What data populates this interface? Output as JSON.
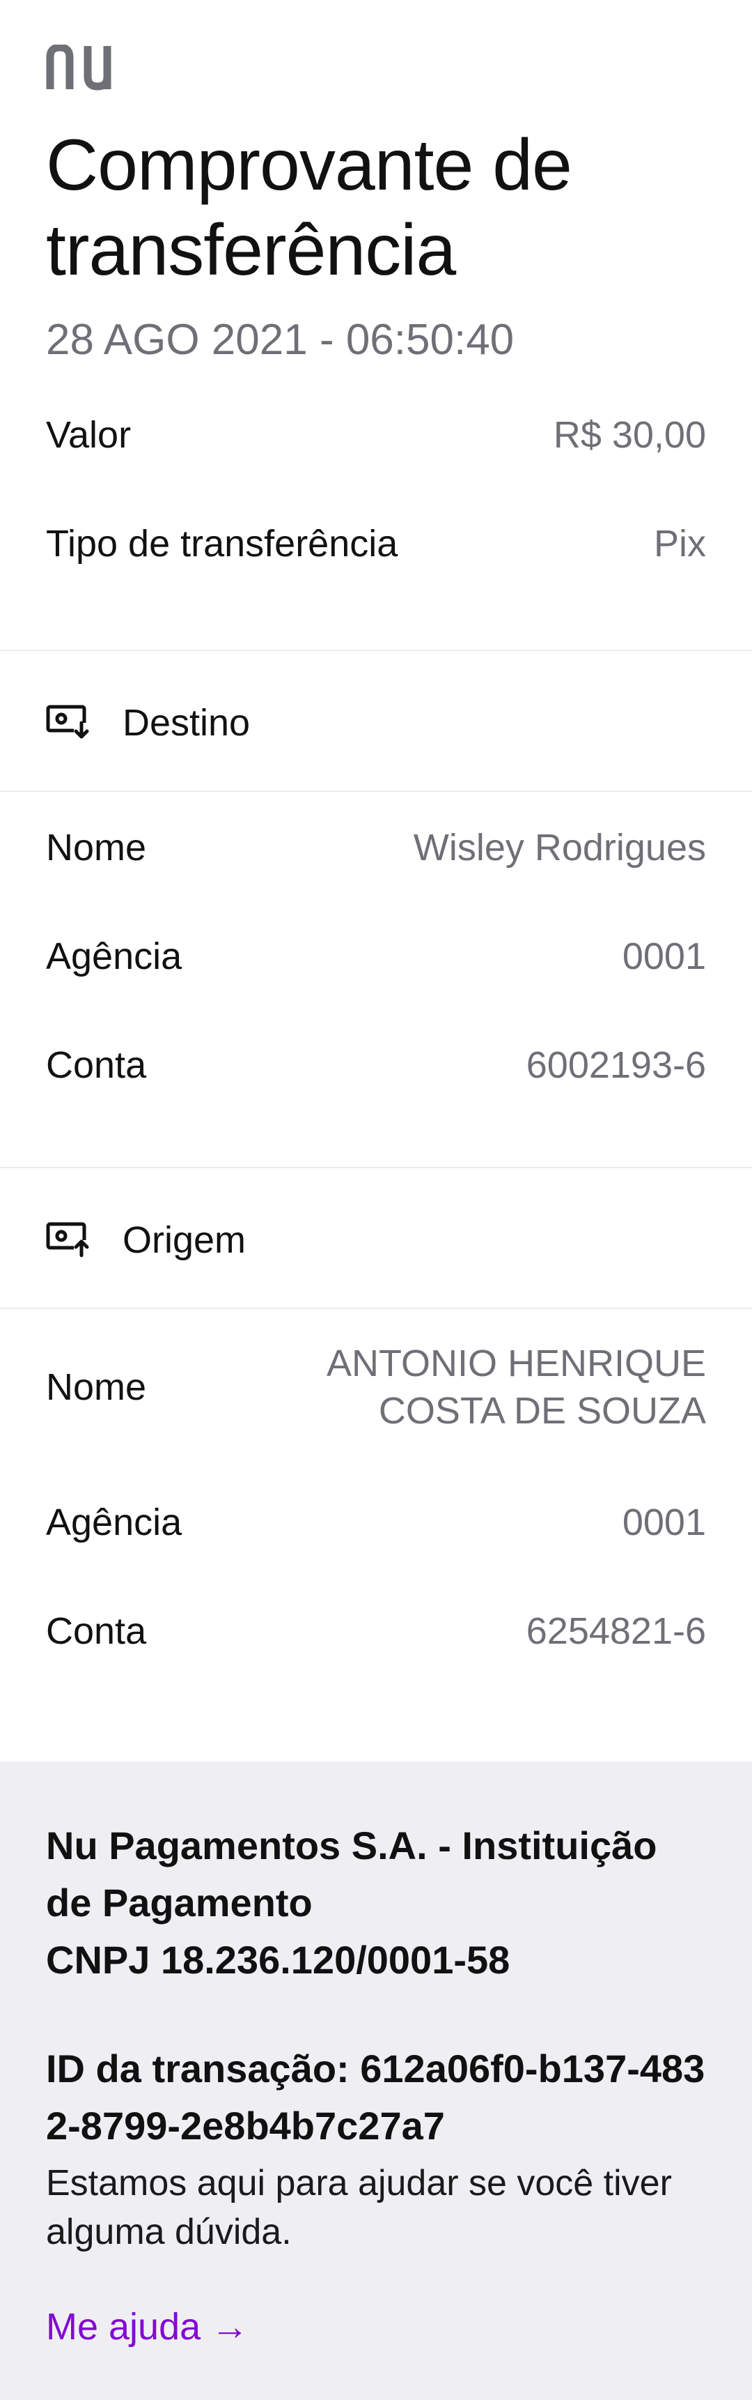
{
  "header": {
    "logo_text": "nu",
    "title": "Comprovante de transferência",
    "datetime": "28 AGO 2021 - 06:50:40"
  },
  "summary": {
    "value_label": "Valor",
    "value": "R$ 30,00",
    "type_label": "Tipo de transferência",
    "type": "Pix"
  },
  "destino": {
    "title": "Destino",
    "name_label": "Nome",
    "name": "Wisley Rodrigues",
    "agency_label": "Agência",
    "agency": "0001",
    "account_label": "Conta",
    "account": "6002193-6"
  },
  "origem": {
    "title": "Origem",
    "name_label": "Nome",
    "name_line1": "ANTONIO HENRIQUE",
    "name_line2": "COSTA DE SOUZA",
    "agency_label": "Agência",
    "agency": "0001",
    "account_label": "Conta",
    "account": "6254821-6"
  },
  "footer": {
    "company_line1": "Nu Pagamentos S.A. - Instituição",
    "company_line2": "de Pagamento",
    "cnpj": "CNPJ 18.236.120/0001-58",
    "txid_label": "ID da transação: ",
    "txid": "612a06f0-b137-4832-8799-2e8b4b7c27a7",
    "help_text": "Estamos aqui para ajudar se você tiver alguma dúvida.",
    "help_link": "Me ajuda →"
  },
  "colors": {
    "brand": "#820ad1",
    "muted_text": "#6f6f77",
    "footer_bg": "#efeff3",
    "logo": "#6f6f77"
  },
  "icons": {
    "destino": "money-in-icon",
    "origem": "money-out-icon"
  }
}
